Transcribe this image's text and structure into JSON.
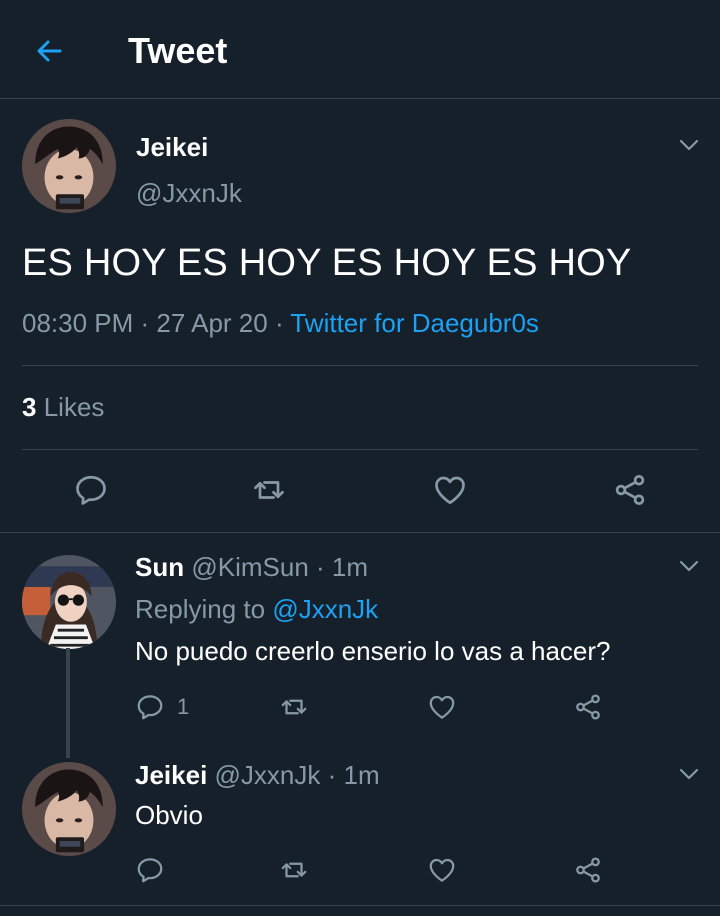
{
  "header": {
    "title": "Tweet"
  },
  "tweet": {
    "name": "Jeikei",
    "handle": "@JxxnJk",
    "text": "ES HOY ES HOY ES HOY ES HOY",
    "time": "08:30 PM",
    "date": "27 Apr 20",
    "source": "Twitter for Daegubr0s",
    "likes_count": "3",
    "likes_label": "Likes"
  },
  "replies": [
    {
      "name": "Sun",
      "handle": "@KimSun",
      "time": "1m",
      "replying_prefix": "Replying to",
      "replying_to": "@JxxnJk",
      "text": "No puedo creerlo enserio lo vas a hacer?",
      "reply_count": "1"
    },
    {
      "name": "Jeikei",
      "handle": "@JxxnJk",
      "time": "1m",
      "text": "Obvio"
    }
  ],
  "colors": {
    "background": "#15202b",
    "accent": "#1da1f2",
    "secondary_text": "#8899a6",
    "divider": "#38444d"
  },
  "icons": [
    "back-arrow-icon",
    "chevron-down-icon",
    "reply-icon",
    "retweet-icon",
    "like-icon",
    "share-icon"
  ]
}
